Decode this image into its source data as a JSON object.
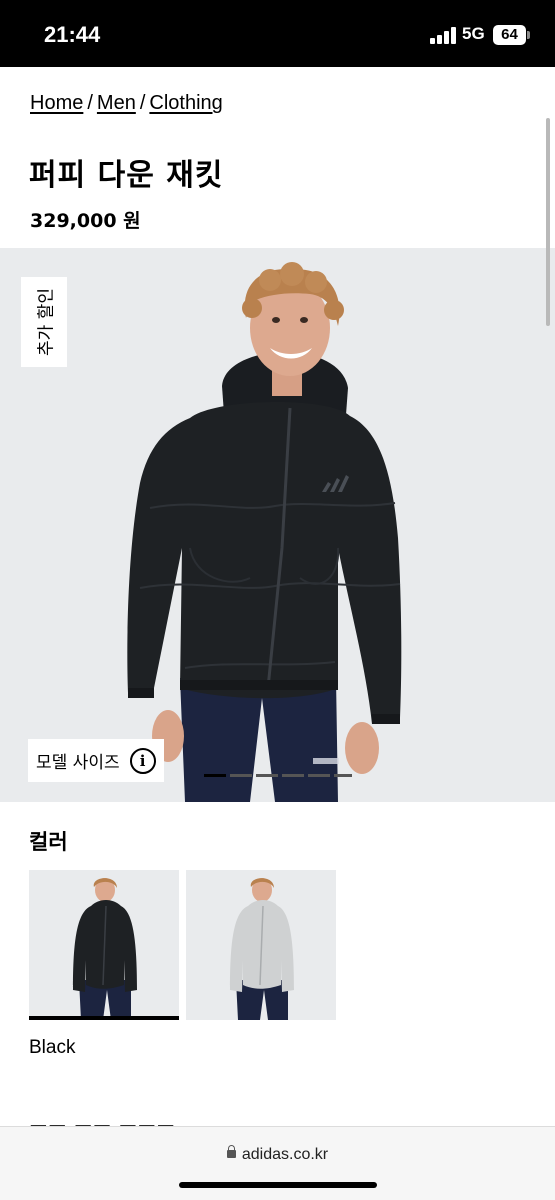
{
  "status_bar": {
    "time": "21:44",
    "network": "5G",
    "battery": "64",
    "icons": [
      "signal-bars-icon",
      "battery-icon"
    ]
  },
  "breadcrumb": {
    "items": [
      "Home",
      "Men",
      "Clothing"
    ],
    "separator": "/"
  },
  "product": {
    "title": "퍼피 다운 재킷",
    "price": "329,000 원"
  },
  "gallery": {
    "promo_tag": "추가 할인",
    "model_size_label": "모델 사이즈",
    "info_icon": "info-icon",
    "current_image_index": 1,
    "image_count": 5
  },
  "colors": {
    "heading": "컬러",
    "options": [
      {
        "name": "Black",
        "jacket_color": "#1e2124",
        "selected": true
      },
      {
        "name": "Grey",
        "jacket_color": "#cfd1d2",
        "selected": false
      }
    ],
    "selected_name": "Black"
  },
  "browser": {
    "url": "adidas.co.kr",
    "lock_icon": "lock-icon"
  },
  "theme": {
    "image_background": "#e9ebed",
    "jacket_black": "#1e2124",
    "pants_navy": "#1c2440"
  }
}
